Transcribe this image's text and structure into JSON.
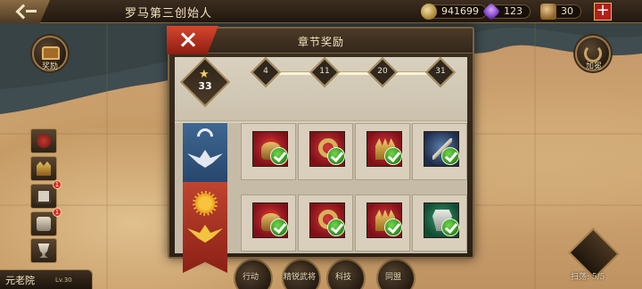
{
  "topbar": {
    "back_label": "",
    "title": "罗马第三创始人",
    "resources": {
      "gold": "941699",
      "gems": "123",
      "troops": "30"
    }
  },
  "left_menu": {
    "reward_label": "奖励",
    "badges": {
      "item3": "1",
      "item4": "1"
    },
    "senate": {
      "name": "元老院",
      "level": "Lv.30"
    }
  },
  "right_menu": {
    "promote_label": "加冕",
    "sweep_label": "扫荡: 5/5"
  },
  "bottom_nav": [
    {
      "label": "行动"
    },
    {
      "label": "精锐武将"
    },
    {
      "label": "科技"
    },
    {
      "label": "同盟"
    }
  ],
  "modal": {
    "title": "章节奖励",
    "total_stars": "33",
    "milestones": [
      "4",
      "11",
      "20",
      "31"
    ],
    "rows": [
      {
        "tier": "silver",
        "items": [
          {
            "icon": "helmet-icon",
            "claimed": true
          },
          {
            "icon": "ring-icon",
            "claimed": true
          },
          {
            "icon": "crown-icon",
            "claimed": true
          },
          {
            "icon": "sword-icon",
            "claimed": true
          }
        ]
      },
      {
        "tier": "gold",
        "items": [
          {
            "icon": "helmet-icon",
            "claimed": true
          },
          {
            "icon": "ring-icon",
            "claimed": true
          },
          {
            "icon": "crown-icon",
            "claimed": true
          },
          {
            "icon": "armor-icon",
            "claimed": true
          }
        ]
      }
    ]
  },
  "colors": {
    "modal_frame": "#3c2f21",
    "close_red": "#c9402a",
    "check_green": "#3fa52a",
    "banner_blue": "#3a6190",
    "banner_red": "#b03a28"
  }
}
